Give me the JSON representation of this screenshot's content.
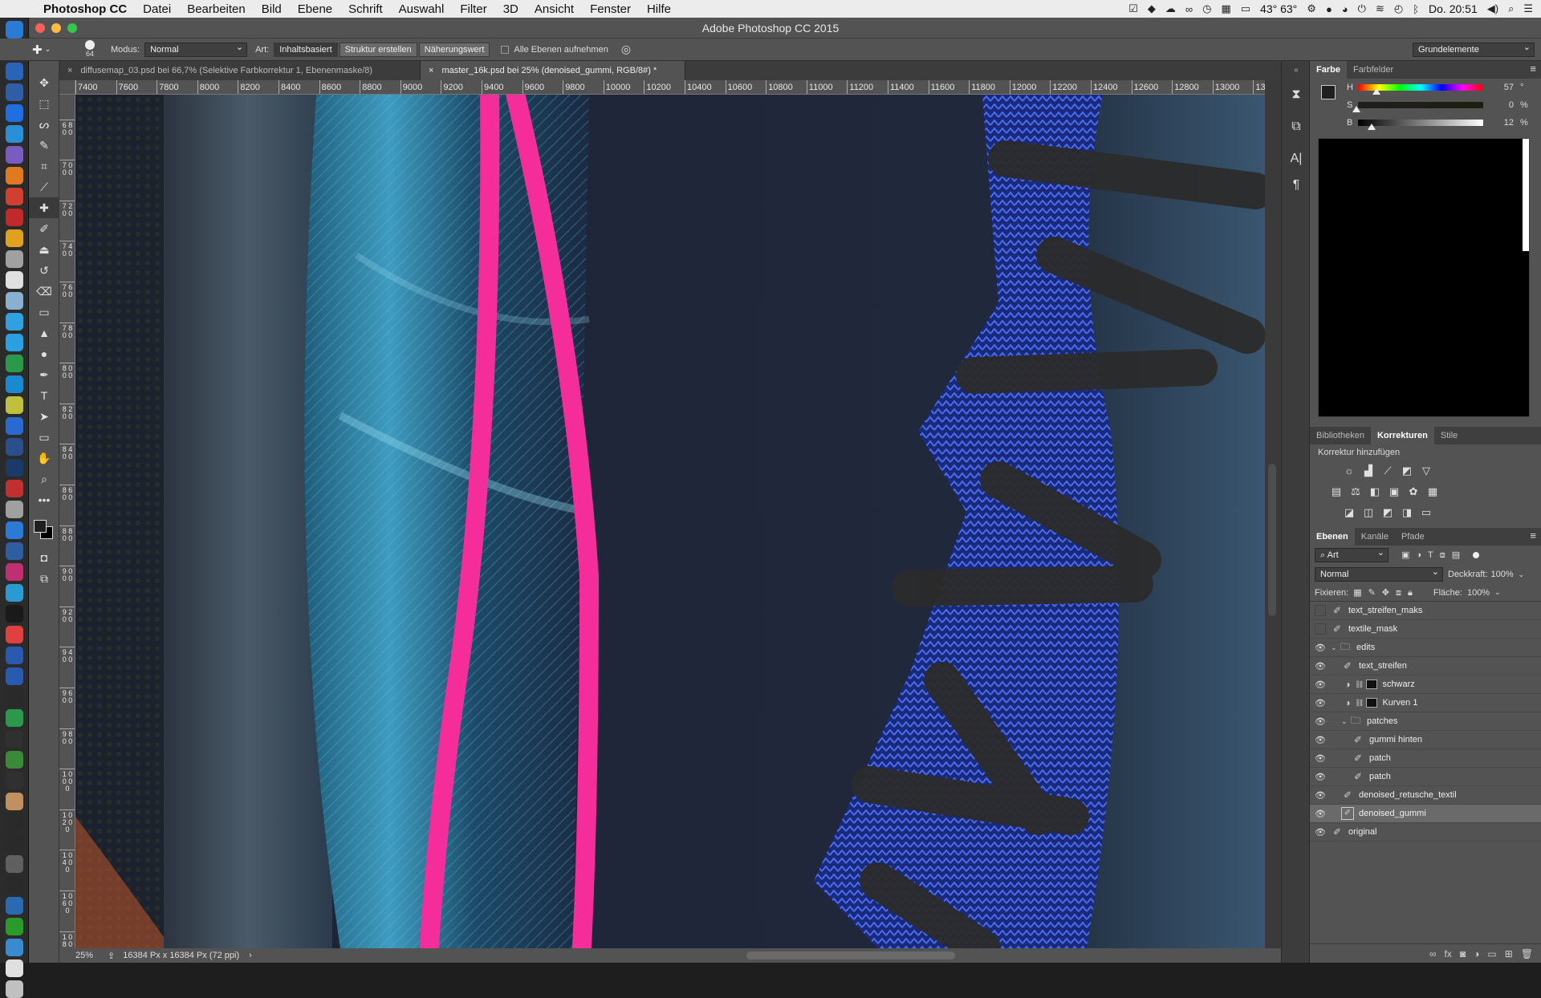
{
  "menubar": {
    "app_name": "Photoshop CC",
    "menus": [
      "Datei",
      "Bearbeiten",
      "Bild",
      "Ebene",
      "Schrift",
      "Auswahl",
      "Filter",
      "3D",
      "Ansicht",
      "Fenster",
      "Hilfe"
    ],
    "temperature": "43° 63°",
    "clock": "Do. 20:51"
  },
  "window": {
    "title": "Adobe Photoshop CC 2015"
  },
  "options": {
    "brush_size": "64",
    "mode_label": "Modus:",
    "mode_value": "Normal",
    "type_label": "Art:",
    "btn_content_aware": "Inhaltsbasiert",
    "btn_create_texture": "Struktur erstellen",
    "btn_proximity": "Näherungswert",
    "sample_all_label": "Alle Ebenen aufnehmen",
    "workspace": "Grundelemente"
  },
  "tabs": [
    {
      "label": "diffusemap_03.psd bei 66,7% (Selektive Farbkorrektur 1, Ebenenmaske/8)"
    },
    {
      "label": "master_16k.psd bei 25% (denoised_gummi, RGB/8#) *"
    }
  ],
  "ruler": {
    "h_ticks": [
      "7400",
      "7600",
      "7800",
      "8000",
      "8200",
      "8400",
      "8600",
      "8800",
      "9000",
      "9200",
      "9400",
      "9600",
      "9800",
      "10000",
      "10200",
      "10400",
      "10600",
      "10800",
      "11000",
      "11200",
      "11400",
      "11600",
      "11800",
      "12000",
      "12200",
      "12400",
      "12600",
      "12800",
      "13000",
      "132"
    ],
    "v_ticks": [
      "6",
      "6 8 0 0",
      "7 0 0 0",
      "7 2 0 0",
      "7 4 0 0",
      "7 6 0 0",
      "7 8 0 0",
      "8 0 0 0",
      "8 2 0 0",
      "8 4 0 0",
      "8 6 0 0",
      "8 8 0 0",
      "9 0 0 0",
      "9 2 0 0",
      "9 4 0 0",
      "9 6 0 0",
      "9 8 0 0",
      "1 0 0 0 0",
      "1 0 2 0 0",
      "1 0 4 0 0",
      "1 0 6 0 0",
      "1 0 8 0 0"
    ]
  },
  "status": {
    "zoom": "25%",
    "doc_info": "16384 Px x 16384 Px (72 ppi)"
  },
  "color_panel": {
    "tabs": [
      "Farbe",
      "Farbfelder"
    ],
    "h_label": "H",
    "h_value": "57",
    "h_unit": "°",
    "h_level": 0.16,
    "s_label": "S",
    "s_value": "0",
    "s_unit": "%",
    "s_level": 0.0,
    "b_label": "B",
    "b_value": "12",
    "b_unit": "%",
    "b_level": 0.12
  },
  "adjust_panel": {
    "tabs": [
      "Bibliotheken",
      "Korrekturen",
      "Stile"
    ],
    "heading": "Korrektur hinzufügen"
  },
  "layers_panel": {
    "tabs": [
      "Ebenen",
      "Kanäle",
      "Pfade"
    ],
    "filter_value": "Art",
    "blend_mode": "Normal",
    "opacity_label": "Deckkraft:",
    "opacity_value": "100%",
    "lock_label": "Fixieren:",
    "fill_label": "Fläche:",
    "fill_value": "100%",
    "layers": [
      {
        "name": "text_streifen_maks",
        "visible": false,
        "indent": 0,
        "kind": "brush"
      },
      {
        "name": "textile_mask",
        "visible": false,
        "indent": 0,
        "kind": "brush"
      },
      {
        "name": "edits",
        "visible": true,
        "indent": 0,
        "kind": "group"
      },
      {
        "name": "text_streifen",
        "visible": true,
        "indent": 1,
        "kind": "brush"
      },
      {
        "name": "schwarz",
        "visible": true,
        "indent": 1,
        "kind": "adjust"
      },
      {
        "name": "Kurven 1",
        "visible": true,
        "indent": 1,
        "kind": "adjust"
      },
      {
        "name": "patches",
        "visible": true,
        "indent": 1,
        "kind": "group"
      },
      {
        "name": "gummi hinten",
        "visible": true,
        "indent": 2,
        "kind": "brush"
      },
      {
        "name": "patch",
        "visible": true,
        "indent": 2,
        "kind": "brush"
      },
      {
        "name": "patch",
        "visible": true,
        "indent": 2,
        "kind": "brush"
      },
      {
        "name": "denoised_retusche_textil",
        "visible": true,
        "indent": 1,
        "kind": "brush"
      },
      {
        "name": "denoised_gummi",
        "visible": true,
        "indent": 1,
        "kind": "smart",
        "selected": true
      },
      {
        "name": "original",
        "visible": true,
        "indent": 0,
        "kind": "brush"
      }
    ]
  }
}
